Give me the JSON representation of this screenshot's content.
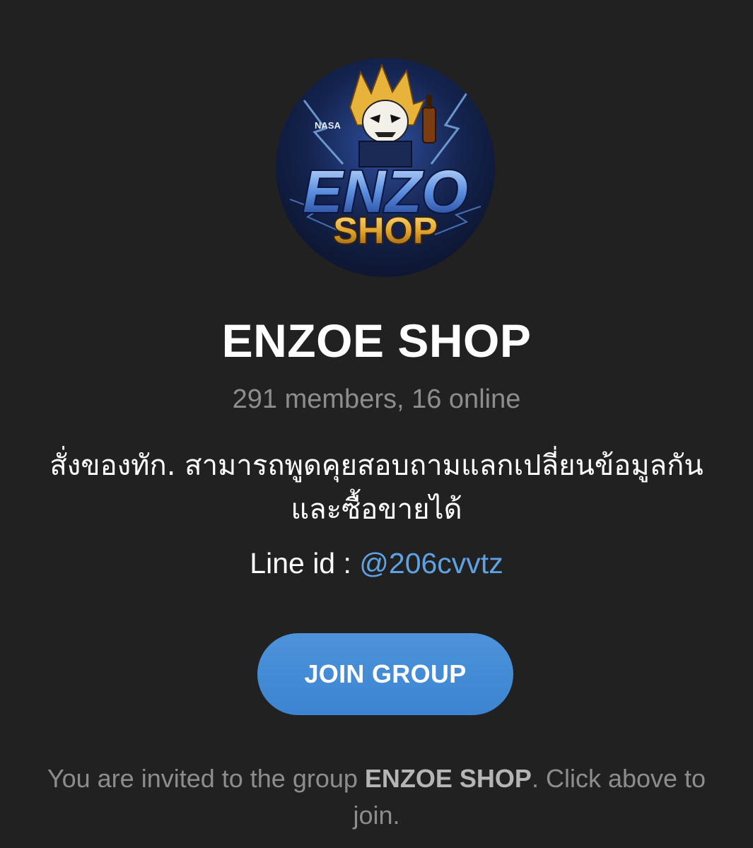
{
  "group": {
    "avatar_icon": "enzo-shop-logo",
    "avatar_text_top": "ENZO",
    "avatar_text_bottom": "SHOP",
    "avatar_badge_text": "NASA",
    "title": "ENZOE SHOP",
    "member_count": "291 members, 16 online",
    "description_line1": "สั่งของทัก. สามารถพูดคุยสอบถามแลกเปลี่ยนข้อมูลกัน",
    "description_line2": "และซื้อขายได้",
    "line_label": "Line id : ",
    "line_id": "@206cvvtz"
  },
  "actions": {
    "join_label": "JOIN GROUP"
  },
  "footer": {
    "invite_prefix": "You are invited to the group ",
    "invite_group": "ENZOE SHOP",
    "invite_suffix": ". Click above to join."
  },
  "colors": {
    "background": "#212121",
    "accent": "#4d93db",
    "link": "#5ea2e3",
    "muted_text": "#8d8d8d"
  }
}
